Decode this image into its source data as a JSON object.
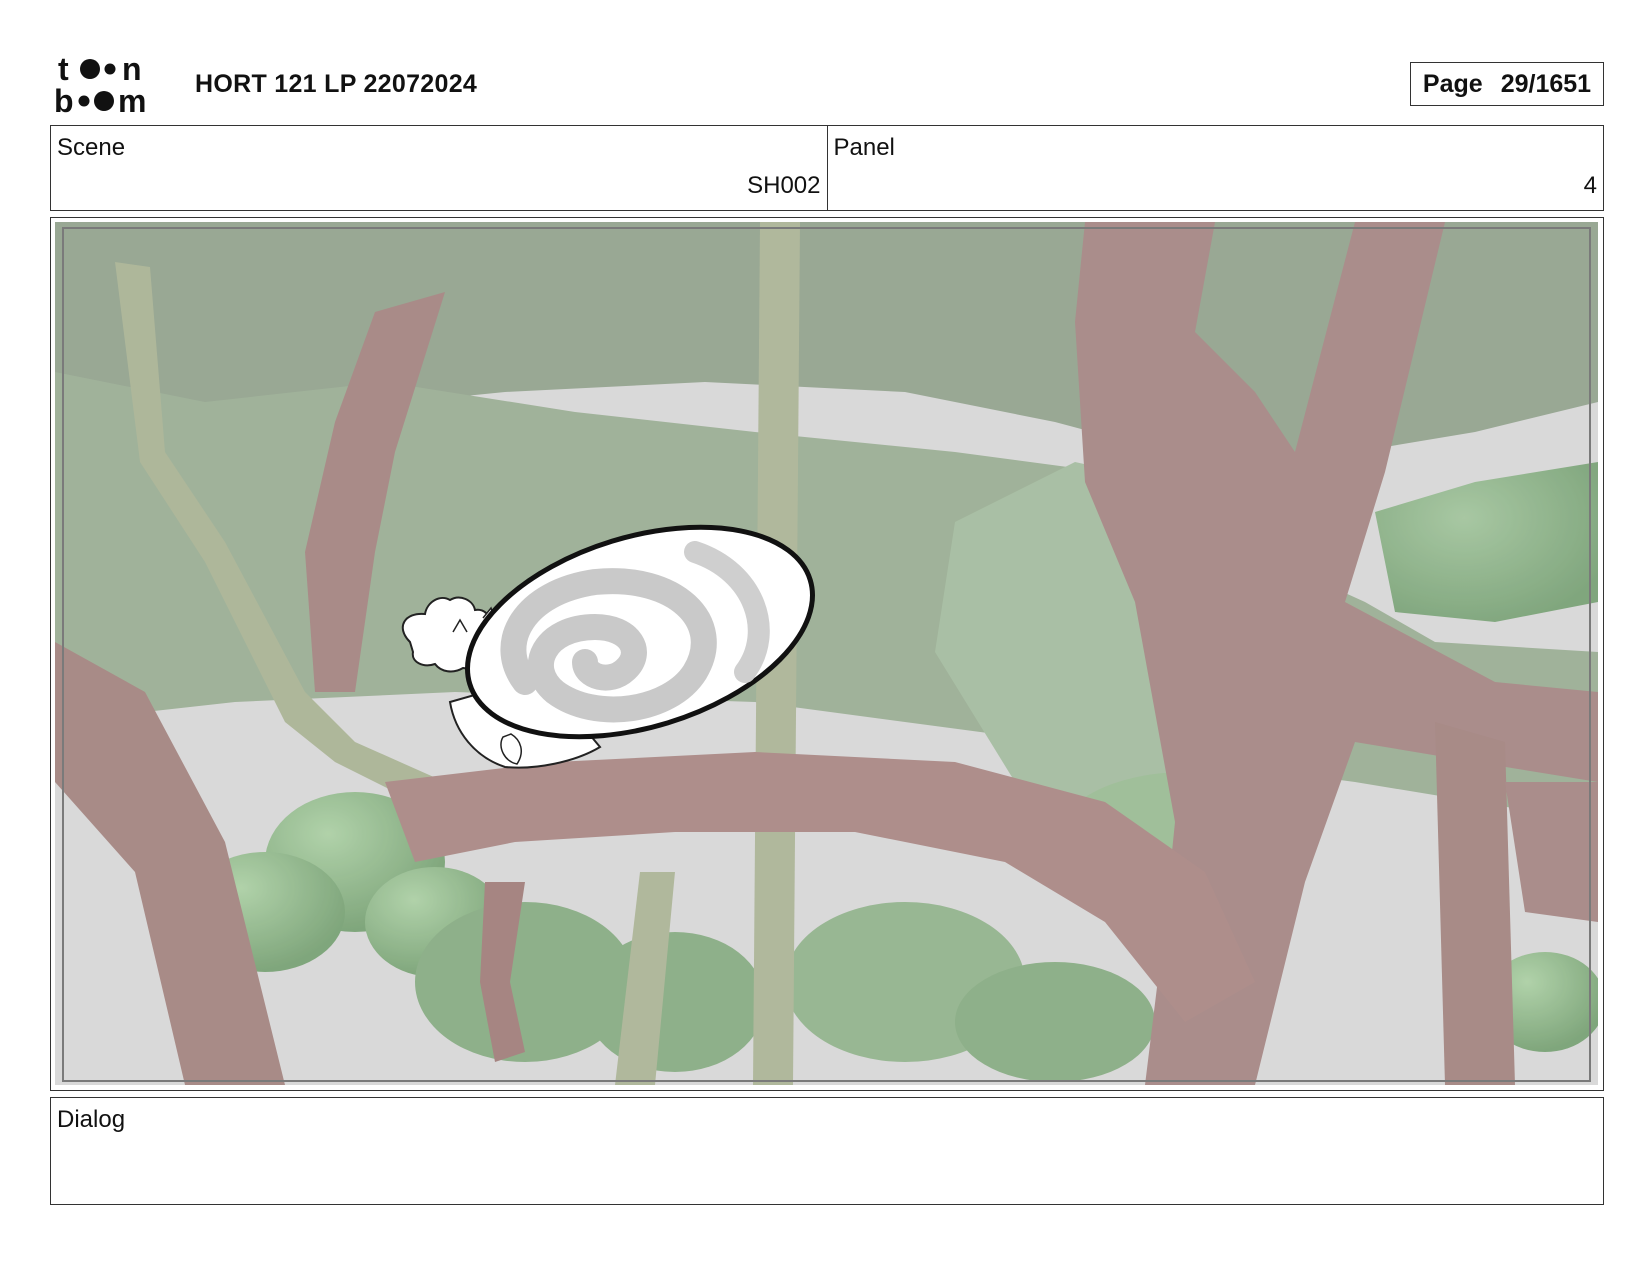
{
  "header": {
    "logo_text": "toon boom",
    "document_title": "HORT 121 LP 22072024",
    "page_label": "Page",
    "page_number": "29/1651"
  },
  "scene": {
    "label": "Scene",
    "value": "SH002"
  },
  "panel": {
    "label": "Panel",
    "value": "4"
  },
  "dialog": {
    "label": "Dialog",
    "value": ""
  },
  "colors": {
    "border": "#333333",
    "sky": "#d2d2d2",
    "foliage": "#8fb08a",
    "branch": "#9e7a76",
    "overlay": "#8c8f88"
  }
}
